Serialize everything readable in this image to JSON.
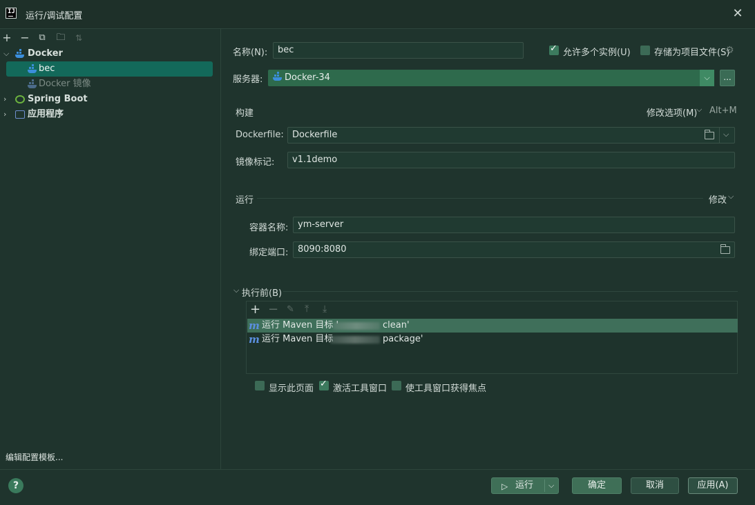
{
  "window": {
    "title": "运行/调试配置"
  },
  "left": {
    "toolbar": [
      "add-icon",
      "remove-icon",
      "copy-icon",
      "new-folder-icon",
      "sort-icon"
    ],
    "tree": [
      {
        "label": "Docker",
        "expanded": true
      },
      {
        "label": "bec",
        "selected": true
      },
      {
        "label": "Docker 镜像"
      },
      {
        "label": "Spring Boot",
        "expanded": false
      },
      {
        "label": "应用程序",
        "expanded": false
      }
    ],
    "edit_templates": "编辑配置模板..."
  },
  "config": {
    "name_label": "名称(N):",
    "name_value": "bec",
    "allow_multiple_label": "允许多个实例(U)",
    "allow_multiple_checked": true,
    "store_as_project_label": "存储为项目文件(S)",
    "store_as_project_checked": false,
    "server_label": "服务器:",
    "server_value": "Docker-34",
    "server_more": "...",
    "build_section": "构建",
    "modify_options": "修改选项(M)",
    "modify_shortcut": "Alt+M",
    "dockerfile_label": "Dockerfile:",
    "dockerfile_value": "Dockerfile",
    "image_tag_label": "镜像标记:",
    "image_tag_value": "v1.1demo",
    "run_section": "运行",
    "run_modify": "修改",
    "container_name_label": "容器名称:",
    "container_name_value": "ym-server",
    "bind_ports_label": "绑定端口:",
    "bind_ports_value": "8090:8080",
    "before_launch_label": "执行前(B)",
    "before_launch_tasks": [
      {
        "prefix": "运行 Maven 目标 '",
        "suffix": "clean'",
        "selected": true
      },
      {
        "prefix": "运行 Maven 目标 ",
        "suffix": "package'",
        "selected": false
      }
    ],
    "show_page_label": "显示此页面",
    "show_page_checked": false,
    "activate_tool_window_label": "激活工具窗口",
    "activate_tool_window_checked": true,
    "focus_tool_window_label": "使工具窗口获得焦点",
    "focus_tool_window_checked": false
  },
  "buttons": {
    "help": "?",
    "run": "运行",
    "ok": "确定",
    "cancel": "取消",
    "apply": "应用(A)"
  },
  "colors": {
    "background": "#1f342d",
    "selection": "#13695a",
    "accent_green": "#3c7a5e",
    "docker_blue": "#3b8edb",
    "maven_blue": "#5b8fe0"
  }
}
